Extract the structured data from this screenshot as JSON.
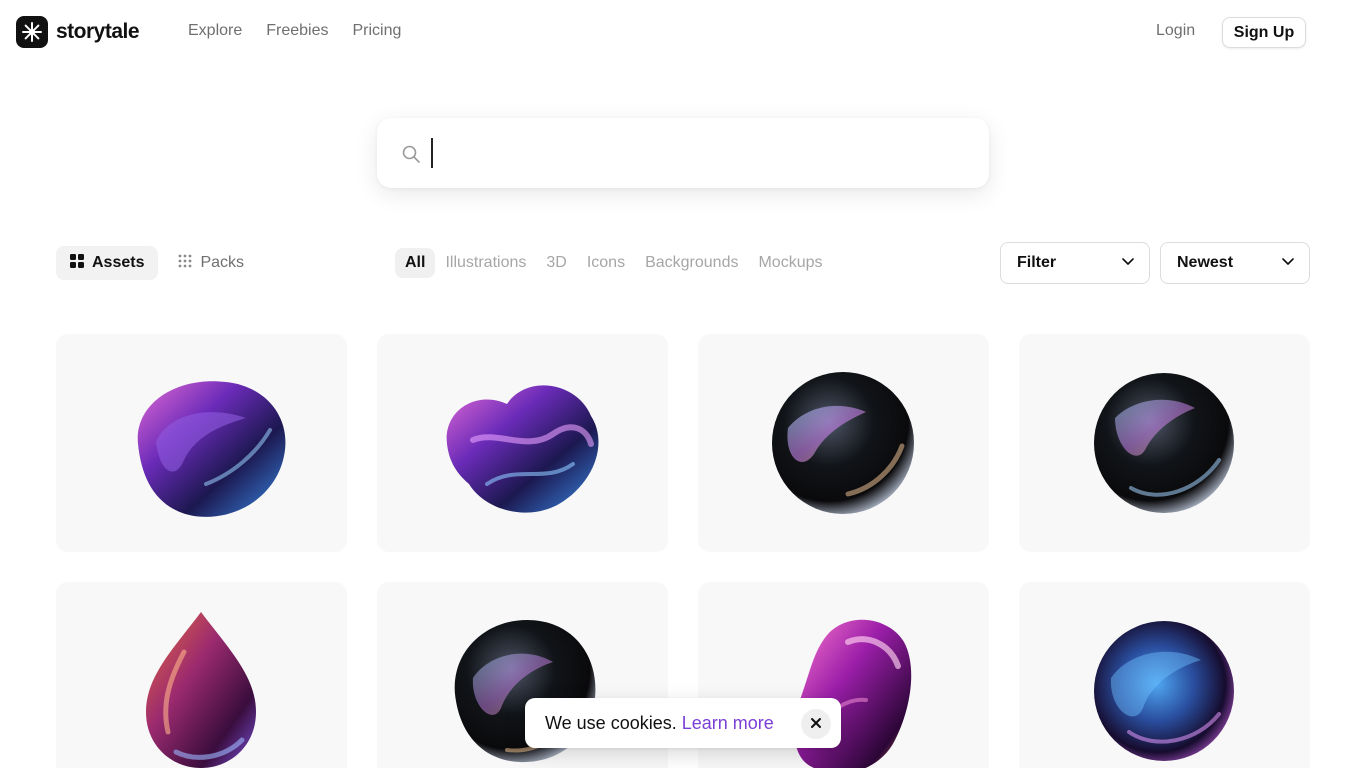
{
  "header": {
    "logo_text": "storytale",
    "nav": [
      "Explore",
      "Freebies",
      "Pricing"
    ],
    "login_label": "Login",
    "signup_label": "Sign Up"
  },
  "search": {
    "value": "",
    "placeholder": ""
  },
  "view_toggle": {
    "assets_label": "Assets",
    "packs_label": "Packs",
    "active": "Assets"
  },
  "categories": {
    "items": [
      "All",
      "Illustrations",
      "3D",
      "Icons",
      "Backgrounds",
      "Mockups"
    ],
    "active": "All"
  },
  "filter_label": "Filter",
  "sort_label": "Newest",
  "grid": {
    "items": [
      {
        "shape": "twisted-ribbon",
        "palette": "purple-blue"
      },
      {
        "shape": "tangled-knot",
        "palette": "purple-blue"
      },
      {
        "shape": "glass-sphere",
        "palette": "dark-iridescent"
      },
      {
        "shape": "glass-sphere",
        "palette": "dark-iridescent"
      },
      {
        "shape": "droplet",
        "palette": "magenta-orange"
      },
      {
        "shape": "glass-blob",
        "palette": "dark-iridescent"
      },
      {
        "shape": "tilted-capsule",
        "palette": "magenta-purple"
      },
      {
        "shape": "glass-sphere",
        "palette": "purple-blue"
      }
    ]
  },
  "cookie": {
    "text": "We use cookies.",
    "link_text": "Learn more"
  },
  "colors": {
    "accent_link": "#7b3fd6",
    "card_background": "#f8f8f8",
    "text_primary": "#111111",
    "text_muted": "#6f6f6f"
  },
  "icons": [
    "storytale-logo-icon",
    "search-icon",
    "assets-grid-icon",
    "packs-dots-icon",
    "chevron-down-icon",
    "close-icon"
  ]
}
